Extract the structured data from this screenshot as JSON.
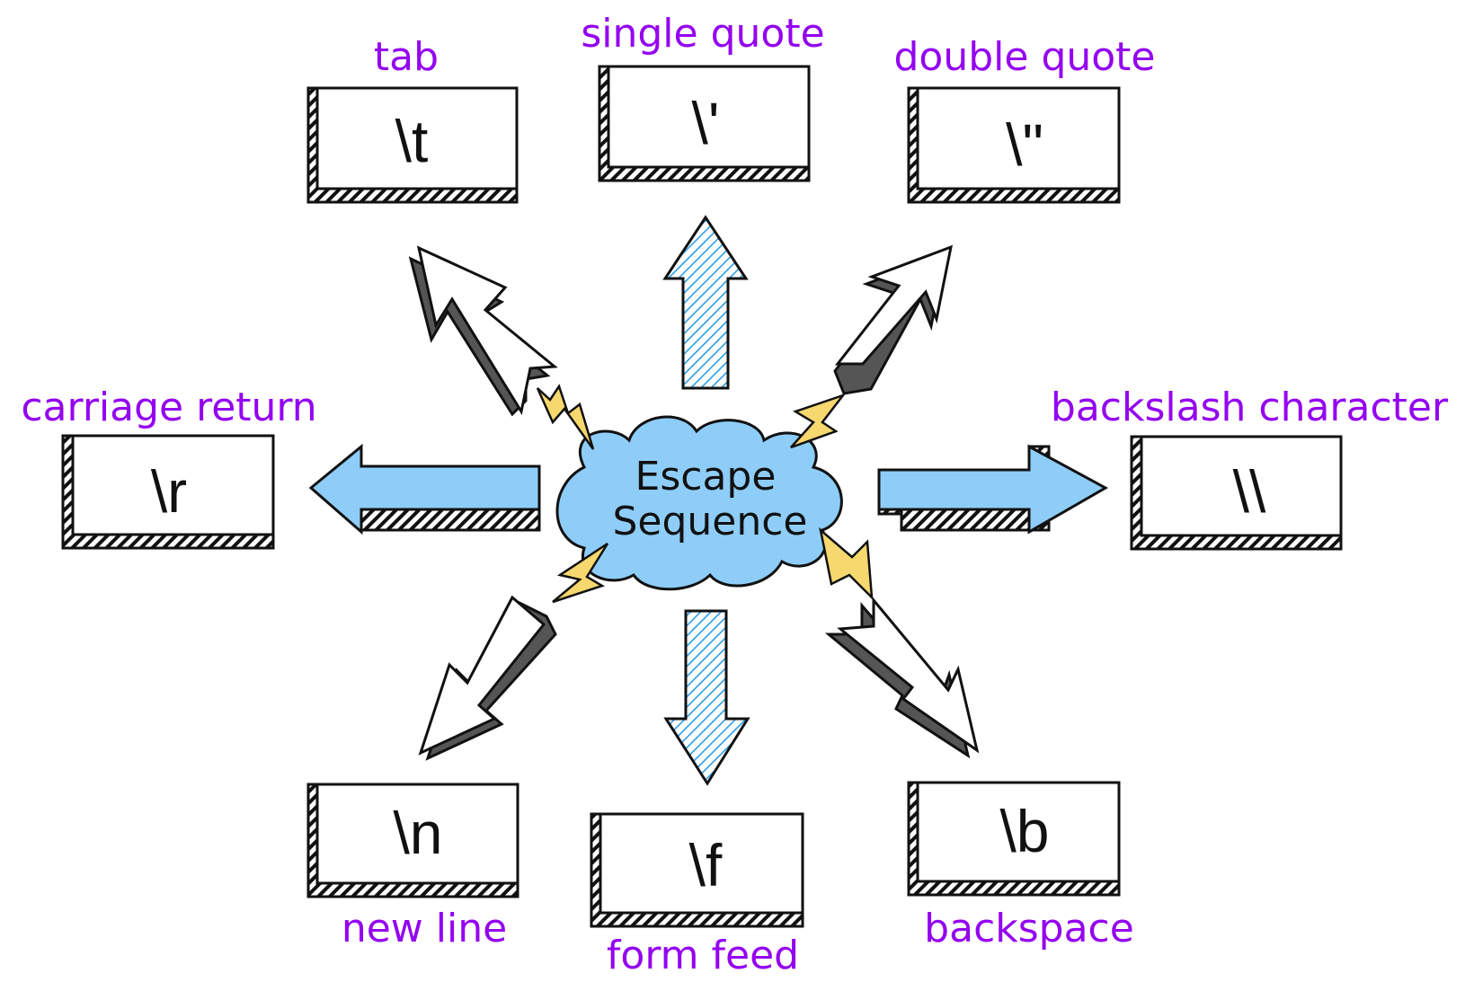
{
  "diagram": {
    "title": "Escape Sequence",
    "center": {
      "line1": "Escape",
      "line2": "Sequence"
    },
    "colors": {
      "label": "#9400f0",
      "cloud": "#8ecdf8",
      "bolt": "#f6d86e",
      "hatch_arrow": "#2a9ee6",
      "solid_arrow": "#8ecdf8",
      "outline": "#111111"
    },
    "nodes": [
      {
        "id": "tab",
        "code": "\\t",
        "label": "tab"
      },
      {
        "id": "single-quote",
        "code": "\\'",
        "label": "single quote"
      },
      {
        "id": "double-quote",
        "code": "\\\"",
        "label": "double quote"
      },
      {
        "id": "carriage-return",
        "code": "\\r",
        "label": "carriage return"
      },
      {
        "id": "backslash",
        "code": "\\\\",
        "label": "backslash character"
      },
      {
        "id": "new-line",
        "code": "\\n",
        "label": "new line"
      },
      {
        "id": "form-feed",
        "code": "\\f",
        "label": "form feed"
      },
      {
        "id": "backspace",
        "code": "\\b",
        "label": "backspace"
      }
    ]
  }
}
